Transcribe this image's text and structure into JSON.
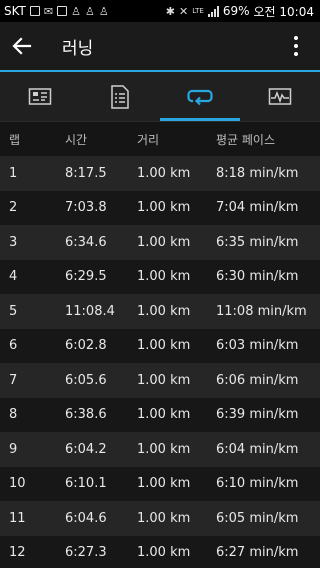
{
  "status_bar": {
    "carrier": "SKT",
    "battery": "69%",
    "time": "오전 10:04",
    "network": "LTE"
  },
  "app_bar": {
    "title": "러닝"
  },
  "tabs": [
    {
      "name": "summary",
      "icon": "flag-stats-icon",
      "active": false
    },
    {
      "name": "details",
      "icon": "document-list-icon",
      "active": false
    },
    {
      "name": "laps",
      "icon": "loop-arrow-icon",
      "active": true
    },
    {
      "name": "graphs",
      "icon": "chart-wave-icon",
      "active": false
    }
  ],
  "table": {
    "headers": [
      "랩",
      "시간",
      "거리",
      "평균 페이스"
    ],
    "rows": [
      [
        "1",
        "8:17.5",
        "1.00 km",
        "8:18 min/km"
      ],
      [
        "2",
        "7:03.8",
        "1.00 km",
        "7:04 min/km"
      ],
      [
        "3",
        "6:34.6",
        "1.00 km",
        "6:35 min/km"
      ],
      [
        "4",
        "6:29.5",
        "1.00 km",
        "6:30 min/km"
      ],
      [
        "5",
        "11:08.4",
        "1.00 km",
        "11:08 min/km"
      ],
      [
        "6",
        "6:02.8",
        "1.00 km",
        "6:03 min/km"
      ],
      [
        "7",
        "6:05.6",
        "1.00 km",
        "6:06 min/km"
      ],
      [
        "8",
        "6:38.6",
        "1.00 km",
        "6:39 min/km"
      ],
      [
        "9",
        "6:04.2",
        "1.00 km",
        "6:04 min/km"
      ],
      [
        "10",
        "6:10.1",
        "1.00 km",
        "6:10 min/km"
      ],
      [
        "11",
        "6:04.6",
        "1.00 km",
        "6:05 min/km"
      ],
      [
        "12",
        "6:27.3",
        "1.00 km",
        "6:27 min/km"
      ]
    ]
  },
  "colors": {
    "accent": "#29a8e0",
    "background": "#101010",
    "row_alt": "#262626"
  }
}
